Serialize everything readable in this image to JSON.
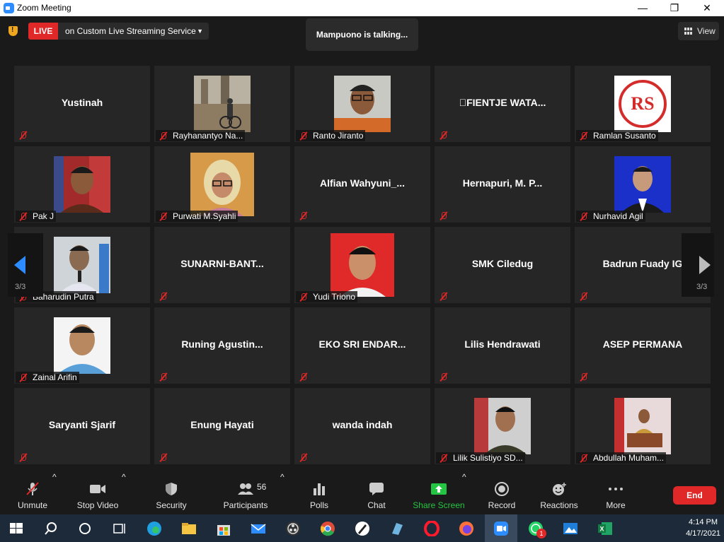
{
  "window": {
    "title": "Zoom Meeting",
    "minimize": "—",
    "maximize": "❐",
    "close": "✕"
  },
  "topbar": {
    "live_badge": "LIVE",
    "live_service": "on Custom Live Streaming Service",
    "talking": "Mampuono is talking...",
    "view_label": "View"
  },
  "pager": {
    "left": "3/3",
    "right": "3/3"
  },
  "tiles": [
    {
      "name": "Yustinah"
    },
    {
      "name": "Rayhanantyo Na..."
    },
    {
      "name": "Ranto Jiranto"
    },
    {
      "name": "\u0000FIENTJE WATA..."
    },
    {
      "name": "Ramlan Susanto",
      "logo_text": "RS"
    },
    {
      "name": "Pak J"
    },
    {
      "name": "Purwati M.Syahli"
    },
    {
      "name": "Alfian  Wahyuni_..."
    },
    {
      "name": "Hernapuri,  M.  P..."
    },
    {
      "name": "Nurhavid Agil"
    },
    {
      "name": "Baharudin Putra"
    },
    {
      "name": "SUNARNI-BANT..."
    },
    {
      "name": "Yudi Triono"
    },
    {
      "name": "SMK Ciledug"
    },
    {
      "name": "Badrun Fuady IG"
    },
    {
      "name": "Zainal Arifin"
    },
    {
      "name": "Runing  Agustin..."
    },
    {
      "name": "EKO SRI ENDAR..."
    },
    {
      "name": "Lilis Hendrawati"
    },
    {
      "name": "ASEP PERMANA"
    },
    {
      "name": "Saryanti Sjarif"
    },
    {
      "name": "Enung Hayati"
    },
    {
      "name": "wanda indah"
    },
    {
      "name": "Lilik Sulistiyo SD..."
    },
    {
      "name": "Abdullah Muham..."
    }
  ],
  "toolbar": {
    "unmute": "Unmute",
    "stop_video": "Stop Video",
    "security": "Security",
    "participants": "Participants",
    "participants_count": "56",
    "polls": "Polls",
    "chat": "Chat",
    "share_screen": "Share Screen",
    "record": "Record",
    "reactions": "Reactions",
    "more": "More",
    "end": "End"
  },
  "taskbar": {
    "time": "4:14 PM",
    "date": "4/17/2021",
    "whatsapp_badge": "1"
  },
  "colors": {
    "accent": "#2d8cff",
    "live": "#e02828",
    "share": "#24c542"
  }
}
